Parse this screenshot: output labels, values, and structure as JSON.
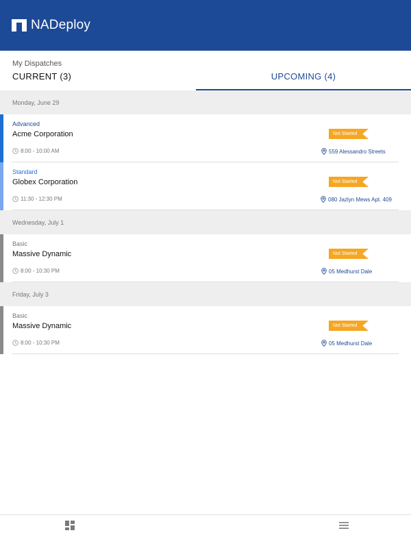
{
  "app": {
    "name": "NADeploy",
    "brand_color": "#1d4a96",
    "accent_color": "#f5a623"
  },
  "page": {
    "title": "My Dispatches"
  },
  "tabs": [
    {
      "label": "CURRENT (3)",
      "active": false
    },
    {
      "label": "UPCOMING (4)",
      "active": true
    }
  ],
  "groups": [
    {
      "date": "Monday, June 29",
      "dispatches": [
        {
          "type": "Advanced",
          "type_color": "#1d4a96",
          "bar_color": "#1d6fd1",
          "company": "Acme Corporation",
          "time": "8:00 - 10:00 AM",
          "status": "Not Started",
          "address": "559 Alessandro Streets"
        },
        {
          "type": "Standard",
          "type_color": "#2d6fd1",
          "bar_color": "#7aa7ee",
          "company": "Globex Corporation",
          "time": "11:30 - 12:30 PM",
          "status": "Not Started",
          "address": "080 Jazlyn Mews Apt. 409"
        }
      ]
    },
    {
      "date": "Wednesday, July 1",
      "dispatches": [
        {
          "type": "Basic",
          "type_color": "#777777",
          "bar_color": "#8a8a8a",
          "company": "Massive Dynamic",
          "time": "8:00 - 10:30 PM",
          "status": "Not Started",
          "address": "05 Medhurst Dale"
        }
      ]
    },
    {
      "date": "Friday, July 3",
      "dispatches": [
        {
          "type": "Basic",
          "type_color": "#777777",
          "bar_color": "#8a8a8a",
          "company": "Massive Dynamic",
          "time": "8:00 - 10:30 PM",
          "status": "Not Started",
          "address": "05 Medhurst Dale"
        }
      ]
    }
  ],
  "icons": {
    "logo": "nadeploy-logo-icon",
    "time": "clock-icon",
    "location": "location-pin-icon",
    "nav_left": "dashboard-grid-icon",
    "nav_right": "hamburger-menu-icon"
  }
}
